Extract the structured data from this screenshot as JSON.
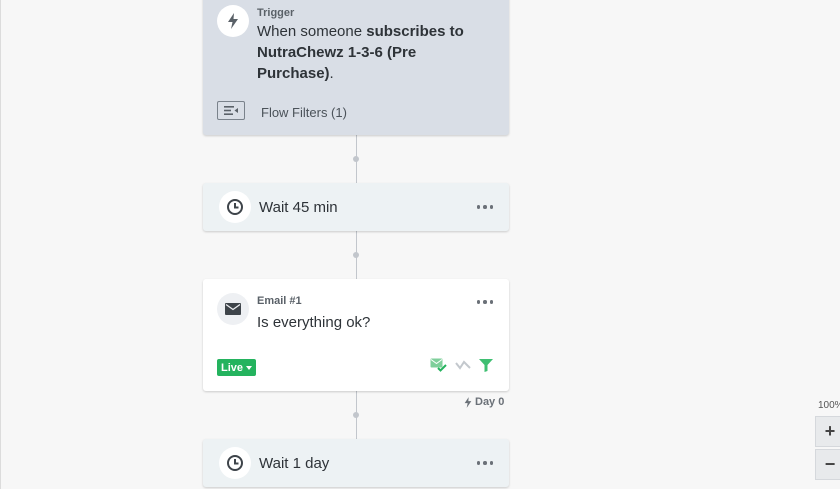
{
  "trigger": {
    "label": "Trigger",
    "prefix": "When someone ",
    "bold": "subscribes to NutraChewz 1-3-6 (Pre Purchase)",
    "suffix": ".",
    "filters_label": "Flow Filters (1)"
  },
  "wait1": {
    "label": "Wait 45 min"
  },
  "email": {
    "label": "Email #1",
    "subject": "Is everything ok?",
    "status": "Live",
    "day_label": "Day 0"
  },
  "wait2": {
    "label": "Wait 1 day"
  },
  "zoom": {
    "level": "100%",
    "in_label": "+",
    "out_label": "−"
  },
  "colors": {
    "live": "#24b35e",
    "trigger_bg": "#d9dee6",
    "wait_bg": "#edf2f4"
  },
  "icons": [
    "bolt-icon",
    "filter-list-icon",
    "clock-icon",
    "mail-icon",
    "more-icon",
    "caret-down-icon",
    "smart-send-icon",
    "skip-icon",
    "filter-icon"
  ]
}
